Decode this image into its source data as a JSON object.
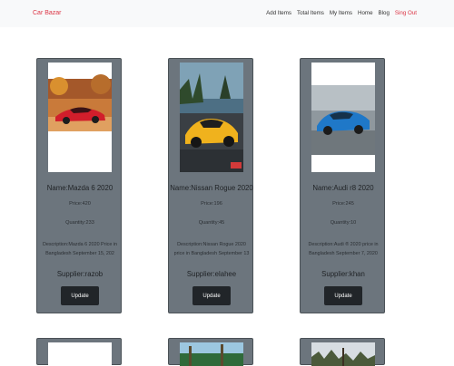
{
  "navbar": {
    "brand": "Car Bazar",
    "links": [
      "Add Items",
      "Total Items",
      "My Items",
      "Home",
      "Blog",
      "Sing Out"
    ]
  },
  "cards": [
    {
      "name": "Name:Mazda 6 2020",
      "price": "Price:420",
      "quantity": "Quantity:233",
      "description": "Description:Mazda 6 2020 Price in Bangladesh September 15, 202",
      "supplier": "Supplier:razob",
      "button": "Update"
    },
    {
      "name": "Name:Nissan Rogue 2020",
      "price": "Price:196",
      "quantity": "Quantity:45",
      "description": "Description:Nissan Rogue 2020 price in Bangladesh September 13",
      "supplier": "Supplier:elahee",
      "button": "Update"
    },
    {
      "name": "Name:Audi r8 2020",
      "price": "Price:245",
      "quantity": "Quantity:10",
      "description": "Description:Audi ® 2020 price in Bangladesh September 7, 2020",
      "supplier": "Supplier:khan",
      "button": "Update"
    }
  ],
  "icons": {
    "car_1": "red-sports-car-image",
    "car_2": "yellow-sports-car-image",
    "car_3": "blue-sports-car-image"
  }
}
